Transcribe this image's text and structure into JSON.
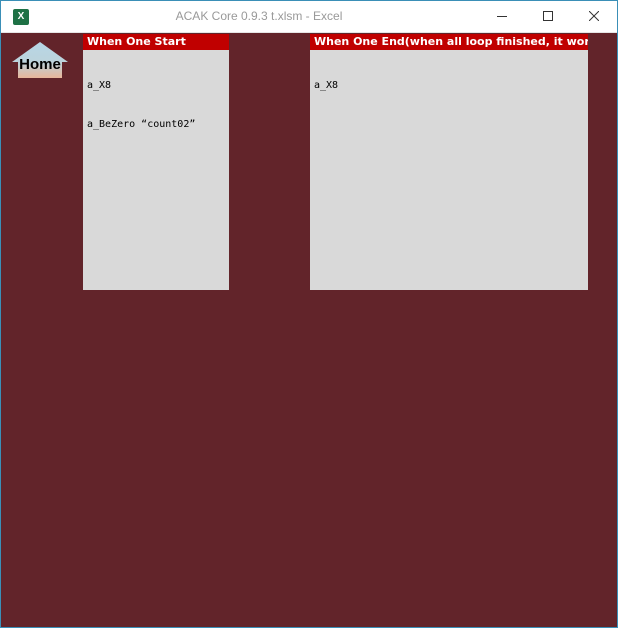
{
  "window": {
    "title": "ACAK Core 0.9.3 t.xlsm - Excel",
    "app_icon_text": "X"
  },
  "sheet": {
    "home_button_label": "Home",
    "panels": {
      "start": {
        "header": "When One Start",
        "lines": [
          "a_X8",
          "a_BeZero “count02”"
        ]
      },
      "end": {
        "header": "When One End(when all loop finished, it works. If One stops",
        "lines": [
          "a_X8"
        ]
      }
    }
  },
  "colors": {
    "sheet_background": "#62242a",
    "panel_header": "#c00000",
    "panel_body": "#d9d9d9",
    "window_border": "#3a8fb7"
  }
}
